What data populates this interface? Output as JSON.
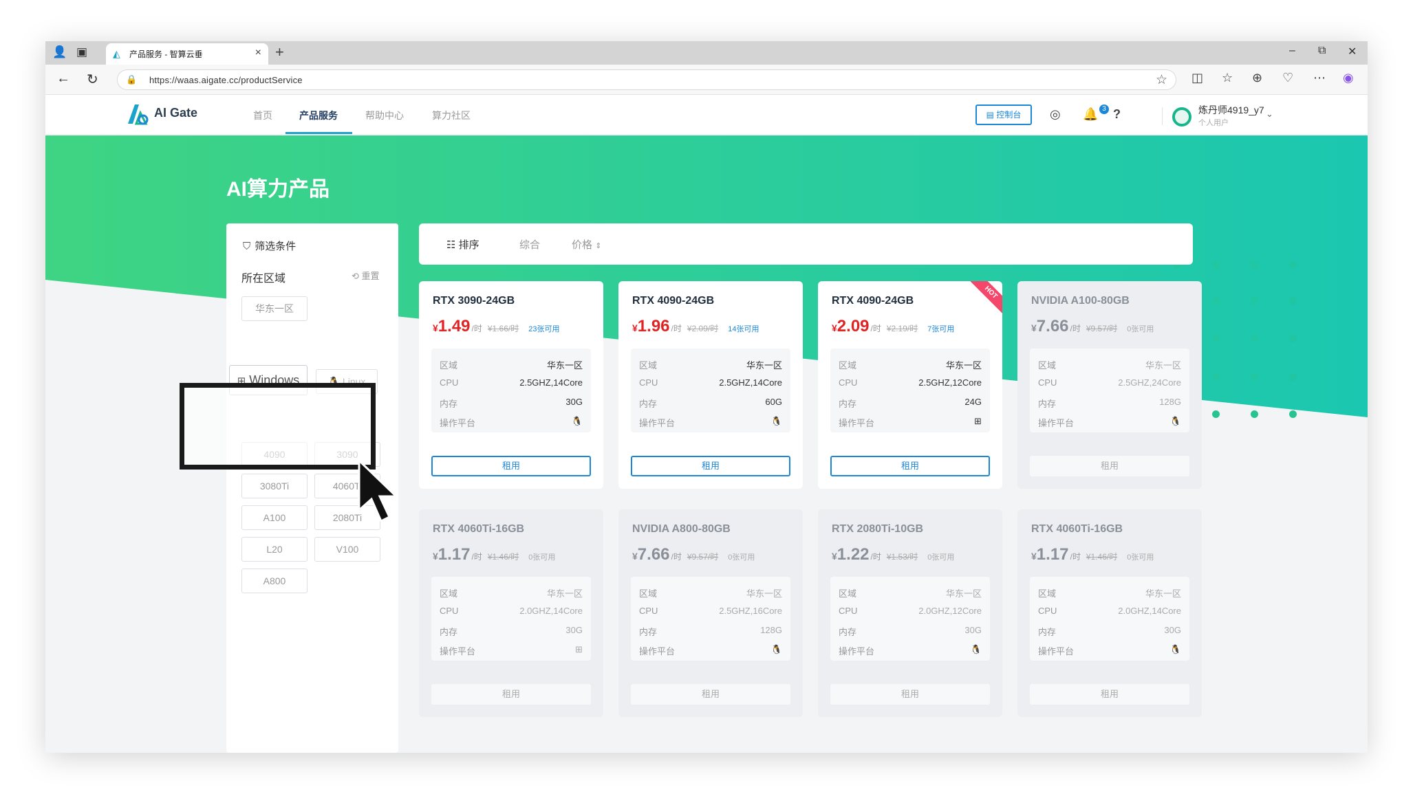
{
  "browser": {
    "tab_title": "产品服务 - 智算云垂",
    "url": "https://waas.aigate.cc/productService"
  },
  "site": {
    "logo_text": "AI Gate",
    "nav": [
      "首页",
      "产品服务",
      "帮助中心",
      "算力社区"
    ],
    "console_button": "控制台",
    "notification_count": "3",
    "help": "?",
    "user_name": "炼丹师4919_y7",
    "user_type": "个人用户"
  },
  "page": {
    "title": "AI算力产品"
  },
  "filter": {
    "title": "筛选条件",
    "region_label": "所在区域",
    "reset": "重置",
    "region_tags": [
      "华东一区"
    ],
    "os_tags": [
      "Windows",
      "Linux"
    ],
    "gpu_tags": [
      "4090",
      "3090",
      "3080Ti",
      "4060Ti",
      "A100",
      "2080Ti",
      "L20",
      "V100",
      "A800"
    ]
  },
  "sort": {
    "label": "排序",
    "comprehensive": "综合",
    "price": "价格"
  },
  "spec_keys": [
    "区域",
    "CPU",
    "内存",
    "操作平台"
  ],
  "rent_label": "租用",
  "products": [
    {
      "name": "RTX 3090-24GB",
      "price": "1.49",
      "unit": "/时",
      "orig": "¥1.66/时",
      "avail": "23张可用",
      "region": "华东一区",
      "cpu": "2.5GHZ,14Core",
      "mem": "30G",
      "os": "linux",
      "available": true,
      "hot": false
    },
    {
      "name": "RTX 4090-24GB",
      "price": "1.96",
      "unit": "/时",
      "orig": "¥2.09/时",
      "avail": "14张可用",
      "region": "华东一区",
      "cpu": "2.5GHZ,14Core",
      "mem": "60G",
      "os": "linux",
      "available": true,
      "hot": false
    },
    {
      "name": "RTX 4090-24GB",
      "price": "2.09",
      "unit": "/时",
      "orig": "¥2.19/时",
      "avail": "7张可用",
      "region": "华东一区",
      "cpu": "2.5GHZ,12Core",
      "mem": "24G",
      "os": "windows",
      "available": true,
      "hot": true,
      "hot_label": "HOT"
    },
    {
      "name": "NVIDIA A100-80GB",
      "price": "7.66",
      "unit": "/时",
      "orig": "¥9.57/时",
      "avail": "0张可用",
      "region": "华东一区",
      "cpu": "2.5GHZ,24Core",
      "mem": "128G",
      "os": "linux",
      "available": false,
      "hot": false
    },
    {
      "name": "RTX 4060Ti-16GB",
      "price": "1.17",
      "unit": "/时",
      "orig": "¥1.46/时",
      "avail": "0张可用",
      "region": "华东一区",
      "cpu": "2.0GHZ,14Core",
      "mem": "30G",
      "os": "windows",
      "available": false,
      "hot": false
    },
    {
      "name": "NVIDIA A800-80GB",
      "price": "7.66",
      "unit": "/时",
      "orig": "¥9.57/时",
      "avail": "0张可用",
      "region": "华东一区",
      "cpu": "2.5GHZ,16Core",
      "mem": "128G",
      "os": "linux",
      "available": false,
      "hot": false
    },
    {
      "name": "RTX 2080Ti-10GB",
      "price": "1.22",
      "unit": "/时",
      "orig": "¥1.53/时",
      "avail": "0张可用",
      "region": "华东一区",
      "cpu": "2.0GHZ,12Core",
      "mem": "30G",
      "os": "linux",
      "available": false,
      "hot": false
    },
    {
      "name": "RTX 4060Ti-16GB",
      "price": "1.17",
      "unit": "/时",
      "orig": "¥1.46/时",
      "avail": "0张可用",
      "region": "华东一区",
      "cpu": "2.0GHZ,14Core",
      "mem": "30G",
      "os": "linux",
      "available": false,
      "hot": false
    }
  ],
  "colors": {
    "accent": "#1b87d6",
    "hero_start": "#3fd483",
    "hero_end": "#1bc7b0",
    "price": "#e02424",
    "hot": "#f5476b"
  }
}
